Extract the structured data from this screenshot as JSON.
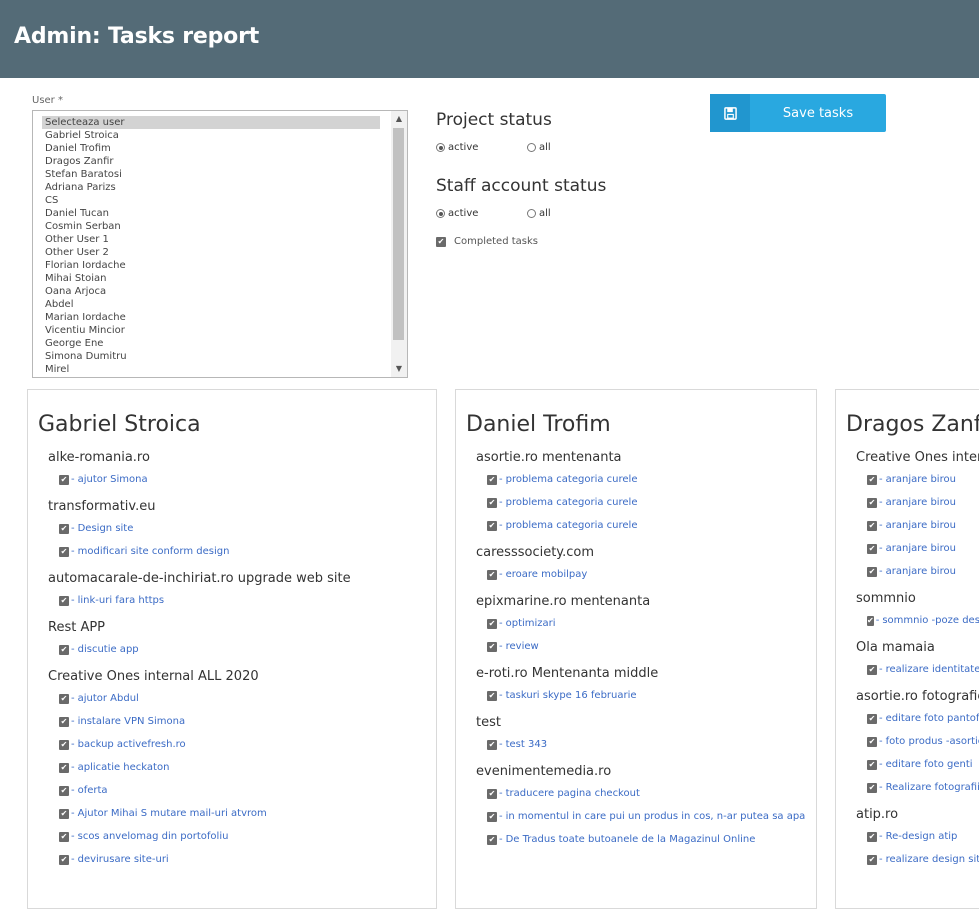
{
  "header": {
    "title": "Admin: Tasks report"
  },
  "user_select": {
    "label": "User *",
    "options": [
      "Selecteaza user",
      "Gabriel Stroica",
      "Daniel Trofim",
      "Dragos Zanfir",
      "Stefan Baratosi",
      "Adriana Parizs",
      "CS",
      "Daniel Tucan",
      "Cosmin Serban",
      "Other User 1",
      "Other User 2",
      "Florian Iordache",
      "Mihai Stoian",
      "Oana Arjoca",
      "Abdel",
      "Marian Iordache",
      "Vicentiu Mincior",
      "George Ene",
      "Simona Dumitru",
      "Mirel"
    ],
    "selected_index": 0
  },
  "project_status": {
    "title": "Project status",
    "active_label": "active",
    "all_label": "all",
    "value": "active"
  },
  "staff_status": {
    "title": "Staff account status",
    "active_label": "active",
    "all_label": "all",
    "value": "active"
  },
  "completed_tasks": {
    "label": "Completed tasks",
    "checked": true
  },
  "save_button": {
    "label": "Save tasks",
    "icon": "floppy-disk-icon"
  },
  "colors": {
    "header_bg": "#546b77",
    "button": "#29a8e0",
    "link": "#3b6bc5"
  },
  "cards": [
    {
      "name": "Gabriel Stroica",
      "projects": [
        {
          "name": "alke-romania.ro",
          "tasks": [
            "ajutor Simona"
          ]
        },
        {
          "name": "transformativ.eu",
          "tasks": [
            "Design site",
            "modificari site conform design"
          ]
        },
        {
          "name": "automacarale-de-inchiriat.ro upgrade web site",
          "tasks": [
            "link-uri fara https"
          ]
        },
        {
          "name": "Rest APP",
          "tasks": [
            "discutie app"
          ]
        },
        {
          "name": "Creative Ones internal ALL 2020",
          "tasks": [
            "ajutor Abdul",
            "instalare VPN Simona",
            "backup activefresh.ro",
            "aplicatie heckaton",
            "oferta",
            "Ajutor Mihai S mutare mail-uri atvrom",
            "scos anvelomag din portofoliu",
            "devirusare site-uri"
          ]
        }
      ]
    },
    {
      "name": "Daniel Trofim",
      "projects": [
        {
          "name": "asortie.ro mentenanta",
          "tasks": [
            "problema categoria curele",
            "problema categoria curele",
            "problema categoria curele"
          ]
        },
        {
          "name": "caresssociety.com",
          "tasks": [
            "eroare mobilpay"
          ]
        },
        {
          "name": "epixmarine.ro mentenanta",
          "tasks": [
            "optimizari",
            "review"
          ]
        },
        {
          "name": "e-roti.ro Mentenanta middle",
          "tasks": [
            "taskuri skype 16 februarie"
          ]
        },
        {
          "name": "test",
          "tasks": [
            "test 343"
          ]
        },
        {
          "name": "evenimentemedia.ro",
          "tasks": [
            "traducere pagina checkout",
            "in momentul in care pui un produs in cos, n-ar putea sa apa",
            "De Tradus toate butoanele de la Magazinul Online"
          ]
        }
      ]
    },
    {
      "name": "Dragos Zanfir",
      "projects": [
        {
          "name": "Creative Ones internal",
          "tasks": [
            "aranjare birou",
            "aranjare birou",
            "aranjare birou",
            "aranjare birou",
            "aranjare birou"
          ]
        },
        {
          "name": "sommnio",
          "tasks": [
            "sommnio -poze design"
          ]
        },
        {
          "name": "Ola mamaia",
          "tasks": [
            "realizare identitate"
          ]
        },
        {
          "name": "asortie.ro fotografie",
          "tasks": [
            "editare foto pantofi",
            "foto produs -asortie",
            "editare foto genti",
            "Realizare fotografii"
          ]
        },
        {
          "name": "atip.ro",
          "tasks": [
            "Re-design atip",
            "realizare design site"
          ]
        }
      ]
    }
  ]
}
